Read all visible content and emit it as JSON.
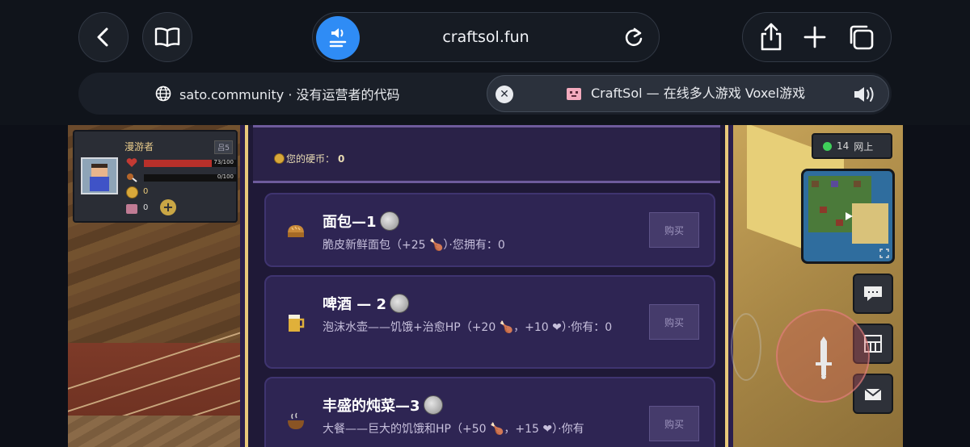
{
  "browser": {
    "url": "craftsol.fun",
    "tabs": [
      {
        "title": "sato.community · 没有运营者的代码",
        "icon": "globe-icon"
      },
      {
        "title": "CraftSol — 在线多人游戏 Voxel游戏",
        "icon": "craftsol-favicon",
        "active": true
      }
    ]
  },
  "hud": {
    "player_name": "漫游者",
    "level": "吕5",
    "health": "73/100",
    "hunger": "0/100",
    "health_fraction": 0.73,
    "hunger_fraction": 0.0,
    "coins": "0",
    "other_count": "0"
  },
  "shop": {
    "coins_label": "您的硬币：",
    "coins_value": "0",
    "items": [
      {
        "name": "面包—1",
        "desc": "脆皮新鲜面包（+25 🍗）·您拥有：0",
        "buy": "购买",
        "icon": "bread-icon"
      },
      {
        "name": "啤酒 — 2",
        "desc": "泡沫水壶——饥饿+治愈HP（+20 🍗，+10 ❤）·你有：0",
        "buy": "购买",
        "icon": "beer-icon"
      },
      {
        "name": "丰盛的炖菜—3",
        "desc": "大餐——巨大的饥饿和HP（+50 🍗，+15 ❤）·你有",
        "buy": "购买",
        "icon": "stew-icon"
      }
    ]
  },
  "right_hud": {
    "online_count": "14",
    "online_label": "网上"
  },
  "colors": {
    "accent": "#2f8cf5",
    "shop_bg": "#1f1937",
    "gold": "#e9c97a",
    "online_dot": "#3fcf5a"
  }
}
